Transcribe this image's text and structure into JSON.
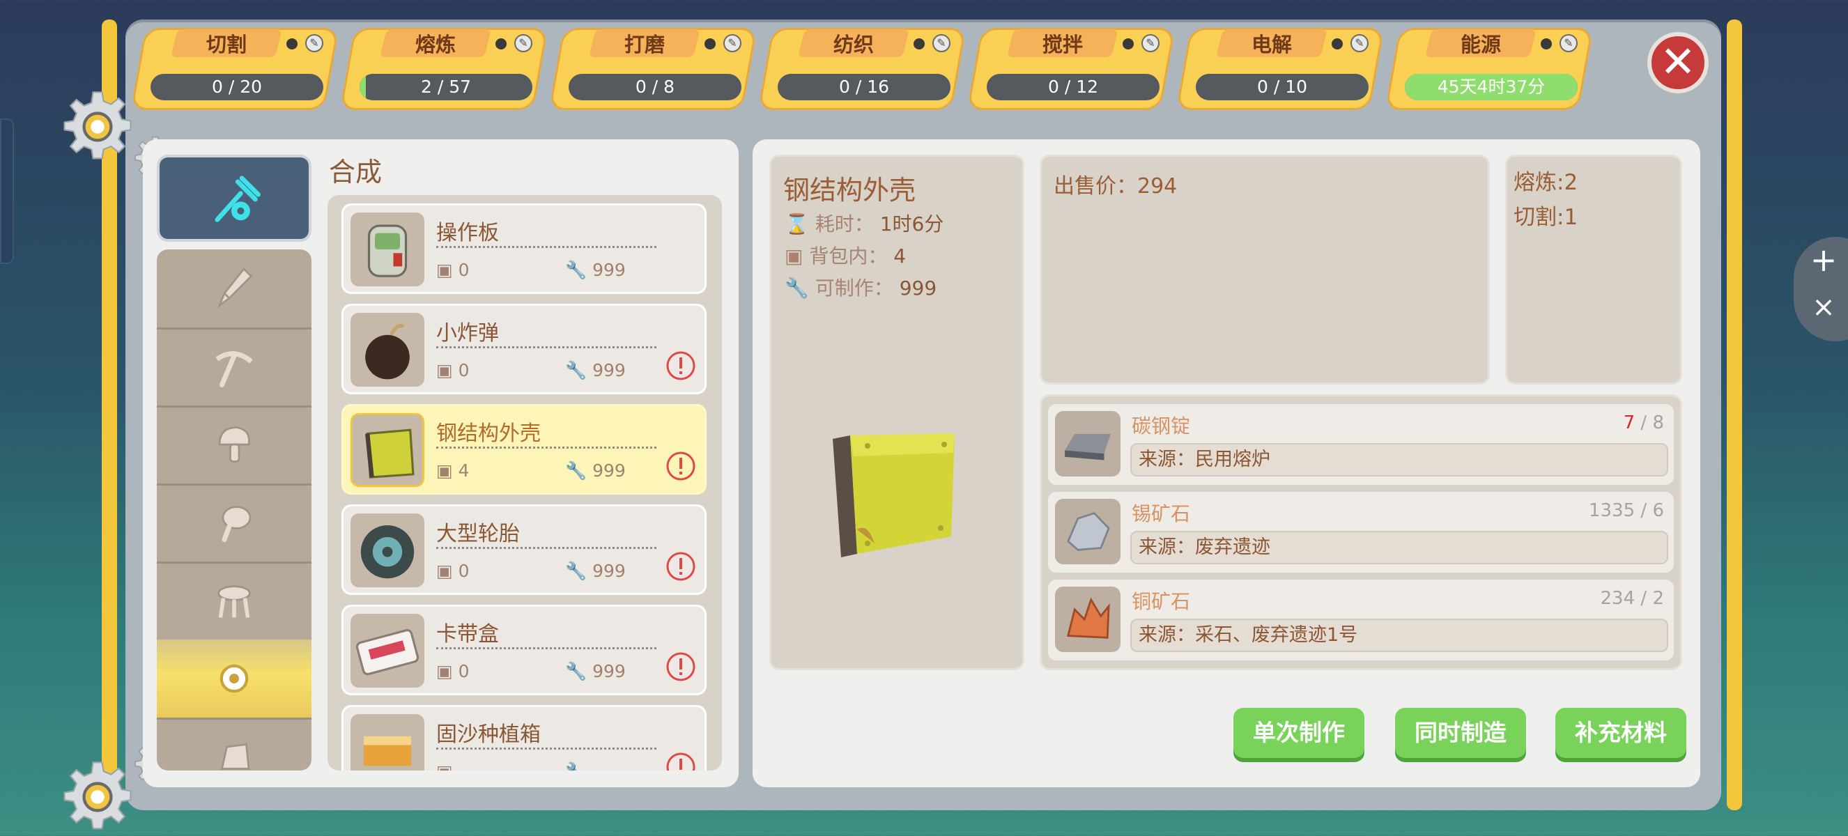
{
  "tabs": [
    {
      "label": "切割",
      "progress": "0 / 20",
      "fill": 0
    },
    {
      "label": "熔炼",
      "progress": "2 / 57",
      "fill": 0.035
    },
    {
      "label": "打磨",
      "progress": "0 / 8",
      "fill": 0
    },
    {
      "label": "纺织",
      "progress": "0 / 16",
      "fill": 0
    },
    {
      "label": "搅拌",
      "progress": "0 / 12",
      "fill": 0
    },
    {
      "label": "电解",
      "progress": "0 / 10",
      "fill": 0
    },
    {
      "label": "能源",
      "progress": "45天4时37分",
      "fill": 1
    }
  ],
  "close_label": "✕",
  "list": {
    "title": "合成",
    "items": [
      {
        "name": "操作板",
        "bag": "0",
        "craftable": "999",
        "warning": false,
        "selected": false,
        "icon": "control-panel-icon"
      },
      {
        "name": "小炸弹",
        "bag": "0",
        "craftable": "999",
        "warning": true,
        "selected": false,
        "icon": "bomb-icon"
      },
      {
        "name": "钢结构外壳",
        "bag": "4",
        "craftable": "999",
        "warning": true,
        "selected": true,
        "icon": "steel-shell-icon"
      },
      {
        "name": "大型轮胎",
        "bag": "0",
        "craftable": "999",
        "warning": true,
        "selected": false,
        "icon": "tire-icon"
      },
      {
        "name": "卡带盒",
        "bag": "0",
        "craftable": "999",
        "warning": true,
        "selected": false,
        "icon": "cassette-icon"
      },
      {
        "name": "固沙种植箱",
        "bag": "",
        "craftable": "",
        "warning": true,
        "selected": false,
        "icon": "planter-box-icon"
      }
    ]
  },
  "detail": {
    "name": "钢结构外壳",
    "time_label": "耗时：",
    "time": "1时6分",
    "bag_label": "背包内：",
    "bag": "4",
    "craft_label": "可制作：",
    "craft": "999",
    "price": "出售价：294",
    "requirements": [
      "熔炼:2",
      "切割:1"
    ]
  },
  "materials": [
    {
      "name": "碳钢锭",
      "have": "7",
      "need": "/ 8",
      "short": true,
      "source": "来源：民用熔炉",
      "icon": "steel-ingot-icon"
    },
    {
      "name": "锡矿石",
      "have": "1335",
      "need": "/ 6",
      "short": false,
      "source": "来源：废弃遗迹",
      "icon": "tin-ore-icon"
    },
    {
      "name": "铜矿石",
      "have": "234",
      "need": "/ 2",
      "short": false,
      "source": "来源：采石、废弃遗迹1号",
      "icon": "copper-ore-icon"
    }
  ],
  "buttons": {
    "single": "单次制作",
    "batch": "同时制造",
    "refill": "补充材料"
  },
  "zoom": {
    "in": "+",
    "out": "×"
  },
  "colors": {
    "tab_yellow": "#f9cf54",
    "button_green": "#79d35a",
    "warning_red": "#d42a2a",
    "panel": "#efefed"
  }
}
